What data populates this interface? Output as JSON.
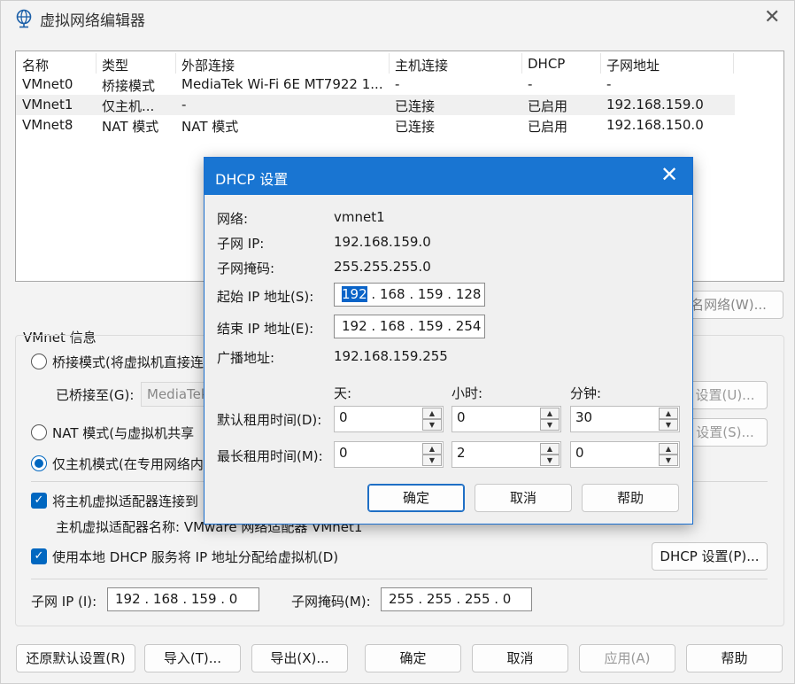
{
  "window": {
    "title": "虚拟网络编辑器",
    "close": "✕"
  },
  "table": {
    "headers": [
      "名称",
      "类型",
      "外部连接",
      "主机连接",
      "DHCP",
      "子网地址"
    ],
    "rows": [
      [
        "VMnet0",
        "桥接模式",
        "MediaTek Wi-Fi 6E MT7922 1...",
        "-",
        "-",
        "-"
      ],
      [
        "VMnet1",
        "仅主机...",
        "-",
        "已连接",
        "已启用",
        "192.168.159.0"
      ],
      [
        "VMnet8",
        "NAT 模式",
        "NAT 模式",
        "已连接",
        "已启用",
        "192.168.150.0"
      ]
    ]
  },
  "rename_button": "名网络(W)...",
  "vmnet_info": {
    "legend": "VMnet 信息",
    "bridge_label": "桥接模式(将虚拟机直接连",
    "bridged_to_label": "已桥接至(G):",
    "bridged_to_value": "MediaTek",
    "auto_settings_button": "设置(U)...",
    "nat_label": "NAT 模式(与虚拟机共享",
    "nat_settings_button": "设置(S)...",
    "host_only_label": "仅主机模式(在专用网络内",
    "connect_adapter_label": "将主机虚拟适配器连接到",
    "adapter_name_label": "主机虚拟适配器名称: VMware 网络适配器 VMnet1",
    "dhcp_label": "使用本地 DHCP 服务将 IP 地址分配给虚拟机(D)",
    "dhcp_settings_button": "DHCP 设置(P)...",
    "subnet_ip_label": "子网 IP (I):",
    "subnet_ip_value": "192 . 168 . 159 .   0",
    "subnet_mask_label": "子网掩码(M):",
    "subnet_mask_value": "255 . 255 . 255 .   0"
  },
  "bottom_buttons": {
    "restore": "还原默认设置(R)",
    "import": "导入(T)...",
    "export": "导出(X)...",
    "ok": "确定",
    "cancel": "取消",
    "apply": "应用(A)",
    "help": "帮助"
  },
  "dhcp_dialog": {
    "title": "DHCP 设置",
    "close": "✕",
    "network_label": "网络:",
    "network_value": "vmnet1",
    "subnet_ip_label": "子网 IP:",
    "subnet_ip_value": "192.168.159.0",
    "subnet_mask_label": "子网掩码:",
    "subnet_mask_value": "255.255.255.0",
    "start_ip_label": "起始 IP 地址(S):",
    "start_ip_first": "192",
    "start_ip_rest": " . 168 . 159 . 128",
    "end_ip_label": "结束 IP 地址(E):",
    "end_ip_value": "192 . 168 . 159 . 254",
    "broadcast_label": "广播地址:",
    "broadcast_value": "192.168.159.255",
    "days_label": "天:",
    "hours_label": "小时:",
    "minutes_label": "分钟:",
    "default_lease_label": "默认租用时间(D):",
    "default_lease": [
      "0",
      "0",
      "30"
    ],
    "max_lease_label": "最长租用时间(M):",
    "max_lease": [
      "0",
      "2",
      "0"
    ],
    "ok": "确定",
    "cancel": "取消",
    "help": "帮助"
  },
  "colors": {
    "accent": "#0067c0",
    "dialog_title": "#1975d2"
  }
}
